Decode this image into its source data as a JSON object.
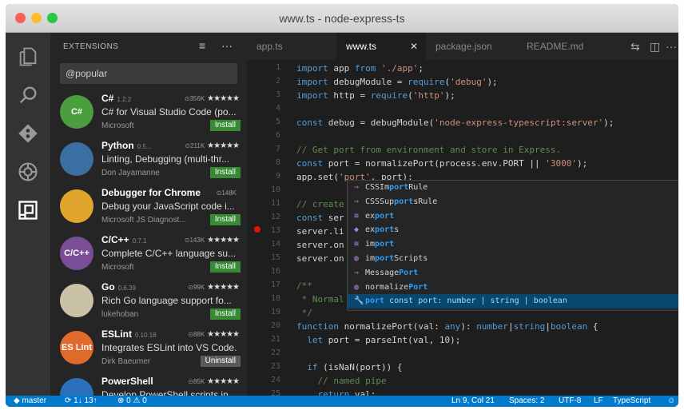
{
  "window": {
    "title": "www.ts - node-express-ts"
  },
  "activity_bar": [
    "explorer-icon",
    "search-icon",
    "git-icon",
    "debug-icon",
    "extensions-icon"
  ],
  "sidebar": {
    "title": "EXTENSIONS",
    "actions": [
      "≡",
      "···"
    ],
    "search_value": "@popular",
    "extensions": [
      {
        "name": "C#",
        "version": "1.2.2",
        "downloads": "356K",
        "stars": "★★★★★",
        "description": "C# for Visual Studio Code (po...",
        "publisher": "Microsoft",
        "action": "Install",
        "icon_text": "C#",
        "icon_color": "#4a9e3e"
      },
      {
        "name": "Python",
        "version": "0.5...",
        "downloads": "211K",
        "stars": "★★★★★",
        "description": "Linting, Debugging (multi-thr...",
        "publisher": "Don Jayamanne",
        "action": "Install",
        "icon_text": "",
        "icon_color": "#3a6fa3"
      },
      {
        "name": "Debugger for Chrome",
        "version": "",
        "downloads": "148K",
        "stars": "",
        "description": "Debug your JavaScript code i...",
        "publisher": "Microsoft JS Diagnost...",
        "action": "Install",
        "icon_text": "",
        "icon_color": "#e0a52a"
      },
      {
        "name": "C/C++",
        "version": "0.7.1",
        "downloads": "143K",
        "stars": "★★★★★",
        "description": "Complete C/C++ language su...",
        "publisher": "Microsoft",
        "action": "Install",
        "icon_text": "C/C++",
        "icon_color": "#7a4d97"
      },
      {
        "name": "Go",
        "version": "0.6.39",
        "downloads": "99K",
        "stars": "★★★★★",
        "description": "Rich Go language support fo...",
        "publisher": "lukehoban",
        "action": "Install",
        "icon_text": "",
        "icon_color": "#c9c1a8"
      },
      {
        "name": "ESLint",
        "version": "0.10.18",
        "downloads": "88K",
        "stars": "★★★★★",
        "description": "Integrates ESLint into VS Code.",
        "publisher": "Dirk Baeumer",
        "action": "Uninstall",
        "icon_text": "ES Lint",
        "icon_color": "#e06a2a"
      },
      {
        "name": "PowerShell",
        "version": "",
        "downloads": "85K",
        "stars": "★★★★★",
        "description": "Develop PowerShell scripts in...",
        "publisher": "",
        "action": "",
        "icon_text": "",
        "icon_color": "#2a6fb8"
      }
    ]
  },
  "tabs": [
    {
      "label": "app.ts",
      "active": false
    },
    {
      "label": "www.ts",
      "active": true
    },
    {
      "label": "package.json",
      "active": false
    },
    {
      "label": "README.md",
      "active": false
    }
  ],
  "code": {
    "line_numbers": [
      "1",
      "2",
      "3",
      "4",
      "5",
      "6",
      "7",
      "8",
      "9",
      "10",
      "11",
      "12",
      "13",
      "14",
      "15",
      "16",
      "17",
      "18",
      "19",
      "20",
      "21",
      "22",
      "23",
      "24",
      "25",
      "26"
    ],
    "lines": [
      "import app from './app';",
      "import debugModule = require('debug');",
      "import http = require('http');",
      "",
      "const debug = debugModule('node-express-typescript:server');",
      "",
      "// Get port from environment and store in Express.",
      "const port = normalizePort(process.env.PORT || '3000');",
      "app.set('port', port);",
      "",
      "// create",
      "const ser",
      "server.li",
      "server.on",
      "server.on",
      "",
      "/**",
      " * Normal",
      " */",
      "function normalizePort(val: any): number|string|boolean {",
      "  let port = parseInt(val, 10);",
      "",
      "  if (isNaN(port)) {",
      "    // named pipe",
      "    return val;",
      ""
    ]
  },
  "suggest": [
    {
      "icon": "⇒",
      "label": "CSSImportRule",
      "detail": ""
    },
    {
      "icon": "⇒",
      "label": "CSSSupportsRule",
      "detail": ""
    },
    {
      "icon": "≡",
      "label": "export",
      "detail": ""
    },
    {
      "icon": "◆",
      "label": "exports",
      "detail": ""
    },
    {
      "icon": "≡",
      "label": "import",
      "detail": ""
    },
    {
      "icon": "◍",
      "label": "importScripts",
      "detail": ""
    },
    {
      "icon": "⇒",
      "label": "MessagePort",
      "detail": ""
    },
    {
      "icon": "◍",
      "label": "normalizePort",
      "detail": ""
    },
    {
      "icon": "🔧",
      "label": "port",
      "detail": "const port: number | string | boolean"
    }
  ],
  "status": {
    "branch": "master",
    "sync": "1↓ 13↑",
    "problems": "0",
    "warnings": "0",
    "position": "Ln 9, Col 21",
    "spaces": "Spaces: 2",
    "encoding": "UTF-8",
    "eol": "LF",
    "language": "TypeScript"
  },
  "colors": {
    "accent": "#007acc",
    "install": "#388a34",
    "breakpoint": "#e51400"
  }
}
